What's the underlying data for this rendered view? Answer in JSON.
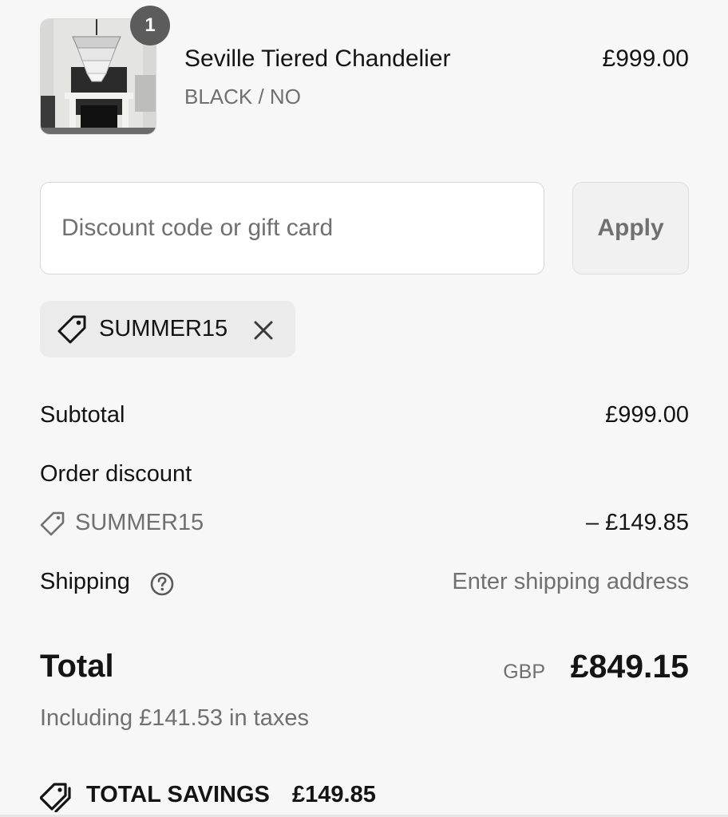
{
  "product": {
    "quantity": "1",
    "name": "Seville Tiered Chandelier",
    "variant": "BLACK / NO",
    "price": "£999.00",
    "image_icon": "chandelier-photo"
  },
  "discount": {
    "placeholder": "Discount code or gift card",
    "value": "",
    "apply_label": "Apply"
  },
  "applied_code": {
    "code": "SUMMER15",
    "icon": "tag-icon",
    "remove_icon": "close-icon"
  },
  "summary": {
    "subtotal_label": "Subtotal",
    "subtotal_value": "£999.00",
    "order_discount_label": "Order discount",
    "discount_code": "SUMMER15",
    "discount_value": "– £149.85",
    "shipping_label": "Shipping",
    "shipping_value": "Enter shipping address",
    "shipping_help_icon": "question-circle-icon"
  },
  "total": {
    "label": "Total",
    "currency": "GBP",
    "value": "£849.15",
    "taxes_note": "Including £141.53 in taxes"
  },
  "savings": {
    "label": "TOTAL SAVINGS",
    "value": "£149.85",
    "icon": "tags-icon"
  },
  "colors": {
    "background": "#f7f7f7",
    "text": "#141414",
    "muted": "#707070",
    "badge": "#5c5c5c",
    "chip": "#ebebeb"
  }
}
